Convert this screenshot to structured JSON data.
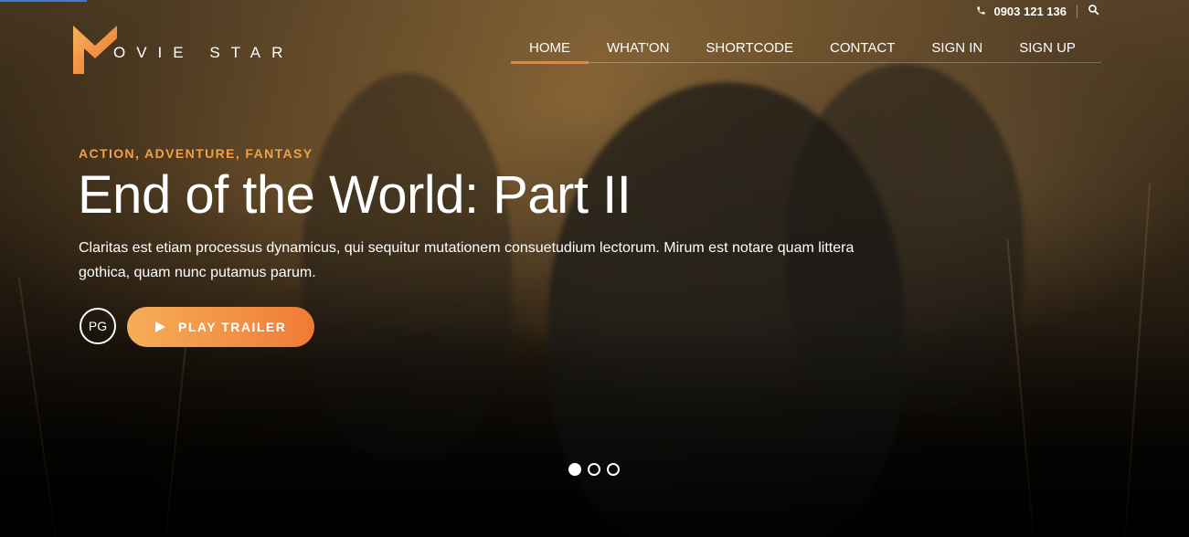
{
  "topbar": {
    "phone_icon": "phone-icon",
    "phone": "0903 121 136",
    "search_icon": "search-icon"
  },
  "brand": {
    "logo_letter": "M",
    "wordmark": "OVIE STAR",
    "accent": "#f0813a"
  },
  "nav": {
    "items": [
      {
        "label": "HOME",
        "active": true
      },
      {
        "label": "WHAT'ON",
        "active": false
      },
      {
        "label": "SHORTCODE",
        "active": false
      },
      {
        "label": "CONTACT",
        "active": false
      },
      {
        "label": "SIGN IN",
        "active": false
      },
      {
        "label": "SIGN UP",
        "active": false
      }
    ]
  },
  "slide": {
    "genre": "ACTION, ADVENTURE, FANTASY",
    "title": "End of the World: Part II",
    "description": "Claritas est etiam processus dynamicus, qui sequitur mutationem consuetudium lectorum. Mirum est notare quam littera gothica, quam nunc putamus parum.",
    "rating": "PG",
    "play_label": "PLAY TRAILER",
    "play_icon": "play-icon"
  },
  "slider": {
    "count": 3,
    "active_index": 0
  },
  "colors": {
    "genre": "#f0a04b",
    "button_start": "#f6ae58",
    "button_end": "#ef7b35"
  }
}
